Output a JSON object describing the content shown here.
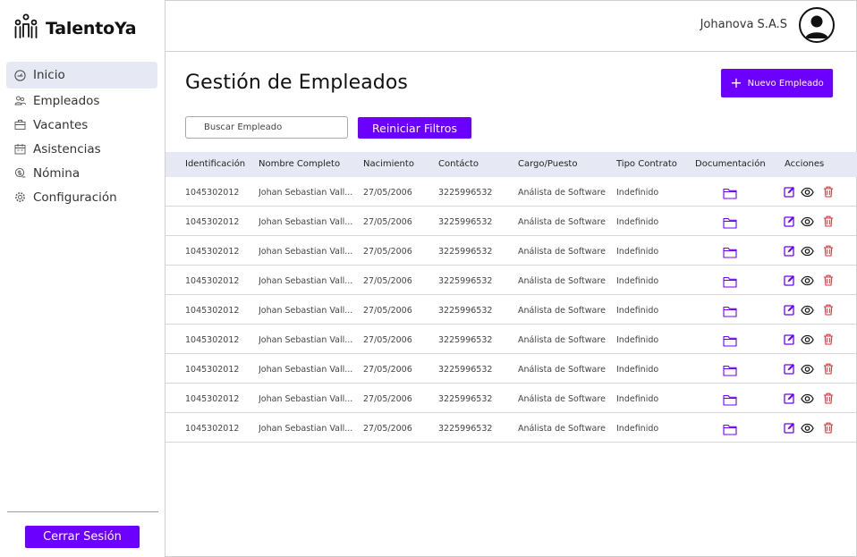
{
  "brand": {
    "name": "TalentoYa"
  },
  "sidebar": {
    "items": [
      {
        "label": "Inicio",
        "icon": "dashboard-gauge-icon",
        "active": true
      },
      {
        "label": "Empleados",
        "icon": "users-icon",
        "active": false
      },
      {
        "label": "Vacantes",
        "icon": "briefcase-icon",
        "active": false
      },
      {
        "label": "Asistencias",
        "icon": "calendar-icon",
        "active": false
      },
      {
        "label": "Nómina",
        "icon": "money-icon",
        "active": false
      },
      {
        "label": "Configuración",
        "icon": "gear-icon",
        "active": false
      }
    ],
    "logout_label": "Cerrar Sesión"
  },
  "header": {
    "company": "Johanova S.A.S",
    "avatar_icon": "user-avatar-icon"
  },
  "main": {
    "title": "Gestión de Empleados",
    "new_button": "Nuevo Empleado",
    "search_placeholder": "Buscar Empleado",
    "reset_button": "Reiniciar Filtros"
  },
  "table": {
    "columns": [
      "Identificación",
      "Nombre Completo",
      "Nacimiento",
      "Contácto",
      "Cargo/Puesto",
      "Tipo Contrato",
      "Documentación",
      "Acciones"
    ],
    "rows": [
      {
        "id": "1045302012",
        "name": "Johan Sebastian Vall...",
        "birth": "27/05/2006",
        "contact": "3225996532",
        "role": "Análista de Software",
        "contract": "Indefinido"
      },
      {
        "id": "1045302012",
        "name": "Johan Sebastian Vall...",
        "birth": "27/05/2006",
        "contact": "3225996532",
        "role": "Análista de Software",
        "contract": "Indefinido"
      },
      {
        "id": "1045302012",
        "name": "Johan Sebastian Vall...",
        "birth": "27/05/2006",
        "contact": "3225996532",
        "role": "Análista de Software",
        "contract": "Indefinido"
      },
      {
        "id": "1045302012",
        "name": "Johan Sebastian Vall...",
        "birth": "27/05/2006",
        "contact": "3225996532",
        "role": "Análista de Software",
        "contract": "Indefinido"
      },
      {
        "id": "1045302012",
        "name": "Johan Sebastian Vall...",
        "birth": "27/05/2006",
        "contact": "3225996532",
        "role": "Análista de Software",
        "contract": "Indefinido"
      },
      {
        "id": "1045302012",
        "name": "Johan Sebastian Vall...",
        "birth": "27/05/2006",
        "contact": "3225996532",
        "role": "Análista de Software",
        "contract": "Indefinido"
      },
      {
        "id": "1045302012",
        "name": "Johan Sebastian Vall...",
        "birth": "27/05/2006",
        "contact": "3225996532",
        "role": "Análista de Software",
        "contract": "Indefinido"
      },
      {
        "id": "1045302012",
        "name": "Johan Sebastian Vall...",
        "birth": "27/05/2006",
        "contact": "3225996532",
        "role": "Análista de Software",
        "contract": "Indefinido"
      },
      {
        "id": "1045302012",
        "name": "Johan Sebastian Vall...",
        "birth": "27/05/2006",
        "contact": "3225996532",
        "role": "Análista de Software",
        "contract": "Indefinido"
      }
    ],
    "row_icons": {
      "documents": "folder-icon",
      "edit": "edit-icon",
      "view": "eye-icon",
      "delete": "trash-icon"
    }
  },
  "colors": {
    "accent": "#6c00ff",
    "active_nav_bg": "#e6e9f3",
    "header_row_bg": "#e6e9f3",
    "delete": "#e03030"
  }
}
